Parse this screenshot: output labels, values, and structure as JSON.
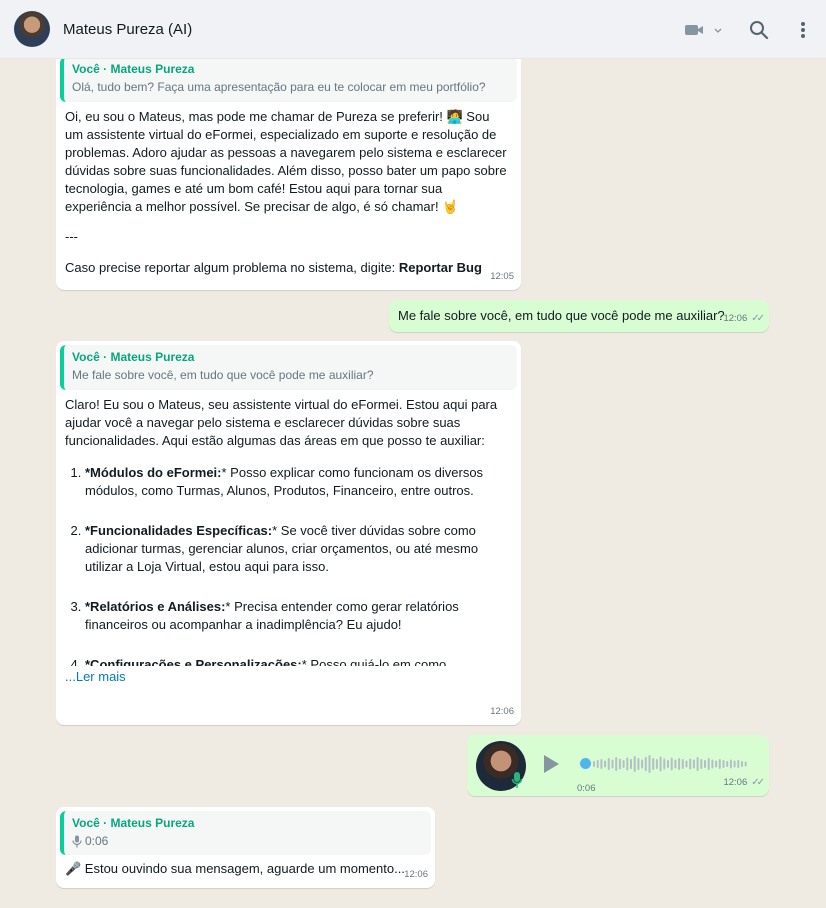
{
  "header": {
    "contact_name": "Mateus Pureza (AI)",
    "icons": [
      "video-icon",
      "chevron-down-icon",
      "search-icon",
      "menu-icon"
    ]
  },
  "messages": {
    "m1": {
      "quote_author": "Você · Mateus Pureza",
      "quote_text": "Olá, tudo bem? Faça uma apresentação para eu te colocar em meu portfólio?",
      "body": "Oi, eu sou o Mateus, mas pode me chamar de Pureza se preferir! 🧑‍💻 Sou um assistente virtual do eFormei, especializado em suporte e resolução de problemas. Adoro ajudar as pessoas a navegarem pelo sistema e esclarecer dúvidas sobre suas funcionalidades. Além disso, posso bater um papo sobre tecnologia, games e até um bom café! Estou aqui para tornar sua experiência a melhor possível. Se precisar de algo, é só chamar! 🤘",
      "separator": "---",
      "report_prefix": "Caso precise reportar algum problema no sistema, digite: ",
      "report_bold": "Reportar Bug",
      "time": "12:05"
    },
    "m2": {
      "body": "Me fale sobre você, em tudo que você pode me auxiliar?",
      "time": "12:06"
    },
    "m3": {
      "quote_author": "Você · Mateus Pureza",
      "quote_text": "Me fale sobre você, em tudo que você pode me auxiliar?",
      "intro": "Claro! Eu sou o Mateus, seu assistente virtual do eFormei. Estou aqui para ajudar você a navegar pelo sistema e esclarecer dúvidas sobre suas funcionalidades. Aqui estão algumas das áreas em que posso te auxiliar:",
      "items": [
        {
          "bold": "*Módulos do eFormei:",
          "text": "* Posso explicar como funcionam os diversos módulos, como Turmas, Alunos, Produtos, Financeiro, entre outros."
        },
        {
          "bold": "*Funcionalidades Específicas:",
          "text": "* Se você tiver dúvidas sobre como adicionar turmas, gerenciar alunos, criar orçamentos, ou até mesmo utilizar a Loja Virtual, estou aqui para isso."
        },
        {
          "bold": "*Relatórios e Análises:",
          "text": "* Precisa entender como gerar relatórios financeiros ou acompanhar a inadimplência? Eu ajudo!"
        },
        {
          "bold": "*Configurações e Personalizações:",
          "text": "* Posso guiá-lo em como personalizar notificações, configurar perfis de usuários e muito"
        }
      ],
      "read_more": "...Ler mais",
      "time": "12:06"
    },
    "m4": {
      "duration": "0:06",
      "time": "12:06",
      "progress": 0
    },
    "m5": {
      "quote_author": "Você · Mateus Pureza",
      "quote_duration": "0:06",
      "body": "🎤 Estou ouvindo sua mensagem, aguarde um momento...",
      "time": "12:06"
    }
  },
  "colors": {
    "chat_bg": "#efeae2",
    "incoming": "#ffffff",
    "outgoing": "#d9fdd3",
    "quote_accent": "#06cf9c",
    "link": "#027eb5",
    "audio_dot": "#4fb6ec"
  }
}
